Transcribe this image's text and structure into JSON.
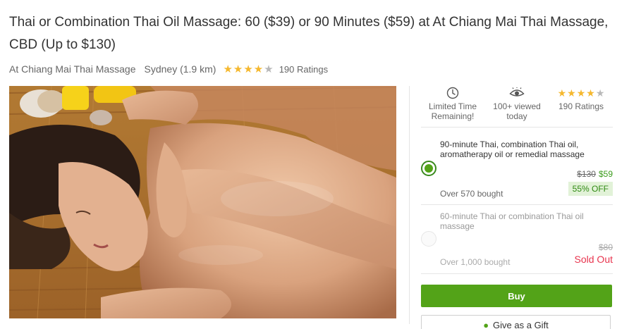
{
  "deal": {
    "title": "Thai or Combination Thai Oil Massage: 60 ($39) or 90 Minutes ($59) at At Chiang Mai Thai Massage, CBD (Up to $130)",
    "merchant": "At Chiang Mai Thai Massage",
    "location": "Sydney (1.9 km)",
    "rating": 4,
    "ratings_label": "190 Ratings"
  },
  "info": {
    "limited_time": "Limited Time Remaining!",
    "viewed": "100+ viewed today",
    "ratings": "190 Ratings"
  },
  "options": [
    {
      "title": "90-minute Thai, combination Thai oil, aromatherapy oil or remedial massage",
      "old_price": "$130",
      "new_price": "$59",
      "discount": "55% OFF",
      "bought": "Over 570 bought",
      "selected": true
    },
    {
      "title": "60-minute Thai or combination Thai oil massage",
      "old_price": "$80",
      "status": "Sold Out",
      "bought": "Over 1,000 bought",
      "selected": false
    }
  ],
  "actions": {
    "buy": "Buy",
    "gift": "Give as a Gift"
  },
  "colors": {
    "accent_green": "#53a318",
    "star": "#f5b82e",
    "sold_out": "#e8344e"
  }
}
